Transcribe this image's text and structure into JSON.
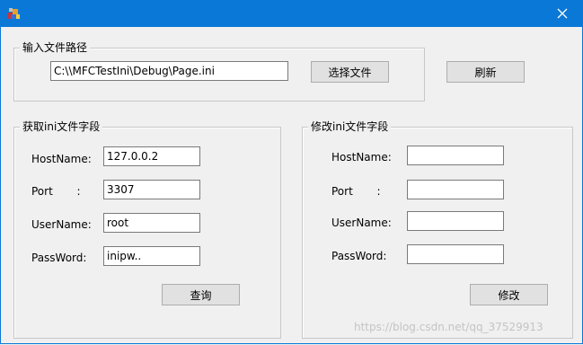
{
  "window": {
    "title": ""
  },
  "groups": {
    "path": "输入文件路径",
    "read": "获取ini文件字段",
    "write": "修改ini文件字段"
  },
  "path_field": {
    "value": "C:\\\\MFCTestIni\\Debug\\Page.ini"
  },
  "buttons": {
    "choose_file": "选择文件",
    "refresh": "刷新",
    "query": "查询",
    "modify": "修改"
  },
  "labels": {
    "hostname": "HostName:",
    "port": "Port       :",
    "username": "UserName:",
    "password": "PassWord:"
  },
  "read_fields": {
    "hostname": "127.0.0.2",
    "port": "3307",
    "username": "root",
    "password": "inipw.."
  },
  "write_fields": {
    "hostname": "",
    "port": "",
    "username": "",
    "password": ""
  },
  "watermark": "https://blog.csdn.net/qq_37529913",
  "colors": {
    "titlebar": "#0a78d7",
    "button_face": "#e1e1e1"
  }
}
